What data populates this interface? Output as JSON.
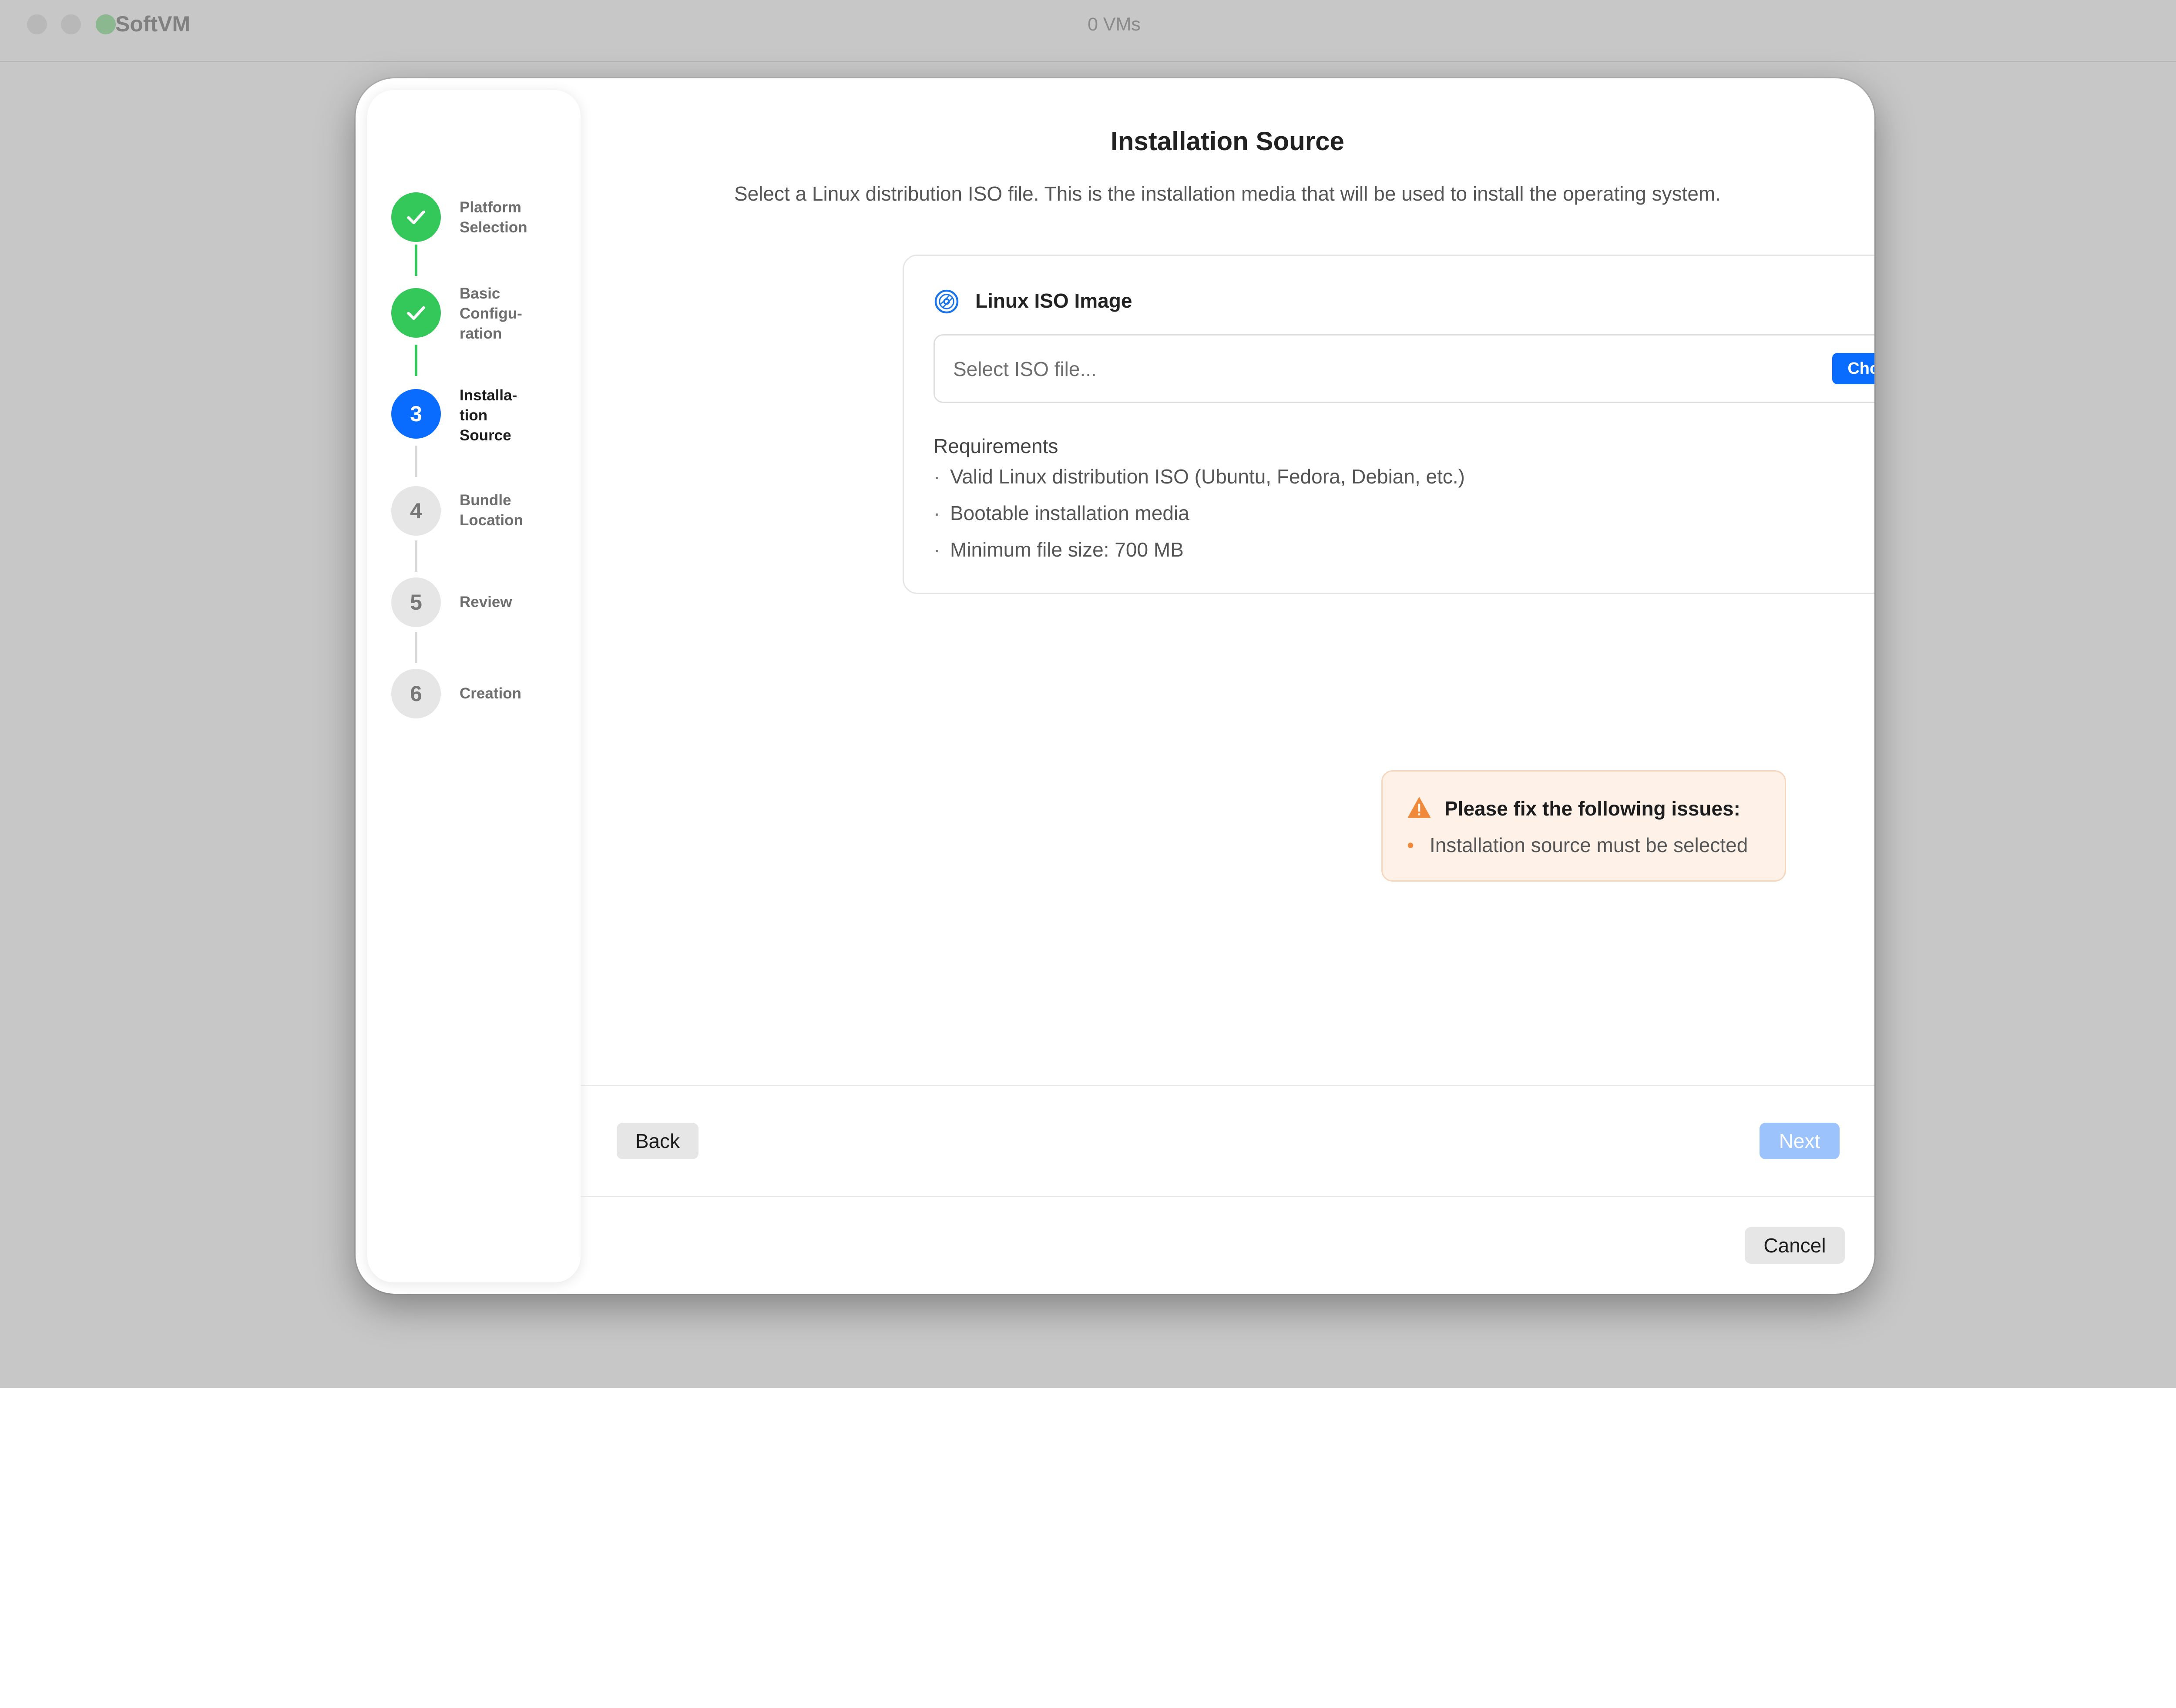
{
  "window": {
    "app_title": "SoftVM",
    "vm_count": "0 VMs"
  },
  "steps": [
    {
      "label": "Platform Selection",
      "lines": [
        "Platform",
        "Selection"
      ],
      "state": "done",
      "marker": "✓"
    },
    {
      "label": "Basic Configuration",
      "lines": [
        "Basic",
        "Configu-",
        "ration"
      ],
      "state": "done",
      "marker": "✓"
    },
    {
      "label": "Installation Source",
      "lines": [
        "Installa-",
        "tion",
        "Source"
      ],
      "state": "active",
      "marker": "3"
    },
    {
      "label": "Bundle Location",
      "lines": [
        "Bundle",
        "Location"
      ],
      "state": "pending",
      "marker": "4"
    },
    {
      "label": "Review",
      "lines": [
        "Review"
      ],
      "state": "pending",
      "marker": "5"
    },
    {
      "label": "Creation",
      "lines": [
        "Creation"
      ],
      "state": "pending",
      "marker": "6"
    }
  ],
  "main": {
    "title": "Installation Source",
    "subtitle": "Select a Linux distribution ISO file. This is the installation media that will be used to install the operating system."
  },
  "iso_card": {
    "icon": "disc-icon",
    "title": "Linux ISO Image",
    "placeholder": "Select ISO file...",
    "choose_button": "Choose File",
    "requirements_title": "Requirements",
    "requirements": [
      "Valid Linux distribution ISO (Ubuntu, Fedora, Debian, etc.)",
      "Bootable installation media",
      "Minimum file size: 700 MB"
    ]
  },
  "warning": {
    "icon": "warning-triangle-icon",
    "title": "Please fix the following issues:",
    "items": [
      "Installation source must be selected"
    ]
  },
  "footer": {
    "back": "Back",
    "next": "Next",
    "cancel": "Cancel"
  },
  "colors": {
    "accent": "#0a6cff",
    "success": "#34c759",
    "warning": "#f08a3a",
    "next_disabled": "#9cc3fb"
  }
}
